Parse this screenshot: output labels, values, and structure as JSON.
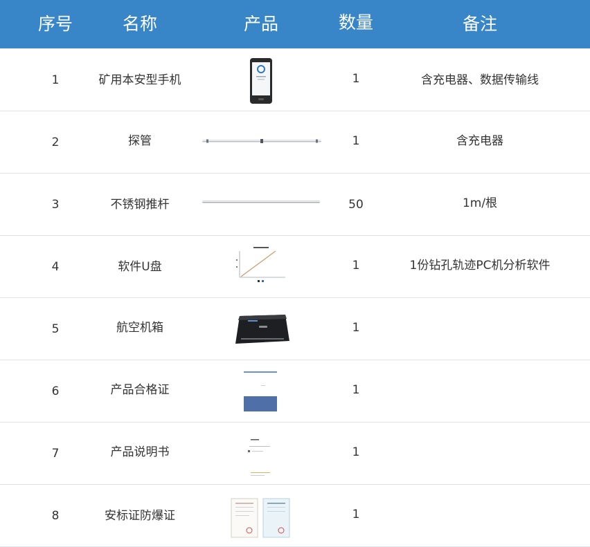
{
  "header": {
    "col_index": "序号",
    "col_name": "名称",
    "col_product": "产品",
    "col_qty": "数量",
    "col_note": "备注"
  },
  "rows": [
    {
      "index": "1",
      "name": "矿用本安型手机",
      "product_icon": "rugged-phone-icon",
      "qty": "1",
      "note": "含充电器、数据传输线"
    },
    {
      "index": "2",
      "name": "探管",
      "product_icon": "probe-tube-icon",
      "qty": "1",
      "note": "含充电器"
    },
    {
      "index": "3",
      "name": "不锈钢推杆",
      "product_icon": "steel-push-rod-icon",
      "qty": "50",
      "note": "1m/根"
    },
    {
      "index": "4",
      "name": "软件U盘",
      "product_icon": "software-chart-icon",
      "qty": "1",
      "note": "1份钻孔轨迹PC机分析软件"
    },
    {
      "index": "5",
      "name": "航空机箱",
      "product_icon": "aviation-case-icon",
      "qty": "1",
      "note": ""
    },
    {
      "index": "6",
      "name": "产品合格证",
      "product_icon": "certificate-card-icon",
      "qty": "1",
      "note": ""
    },
    {
      "index": "7",
      "name": "产品说明书",
      "product_icon": "manual-document-icon",
      "qty": "1",
      "note": ""
    },
    {
      "index": "8",
      "name": "安标证防爆证",
      "product_icon": "safety-certificates-icon",
      "qty": "1",
      "note": ""
    }
  ],
  "colors": {
    "header_bg": "#3886c8",
    "header_text": "#ffffff",
    "row_border": "#dfe3e7"
  }
}
